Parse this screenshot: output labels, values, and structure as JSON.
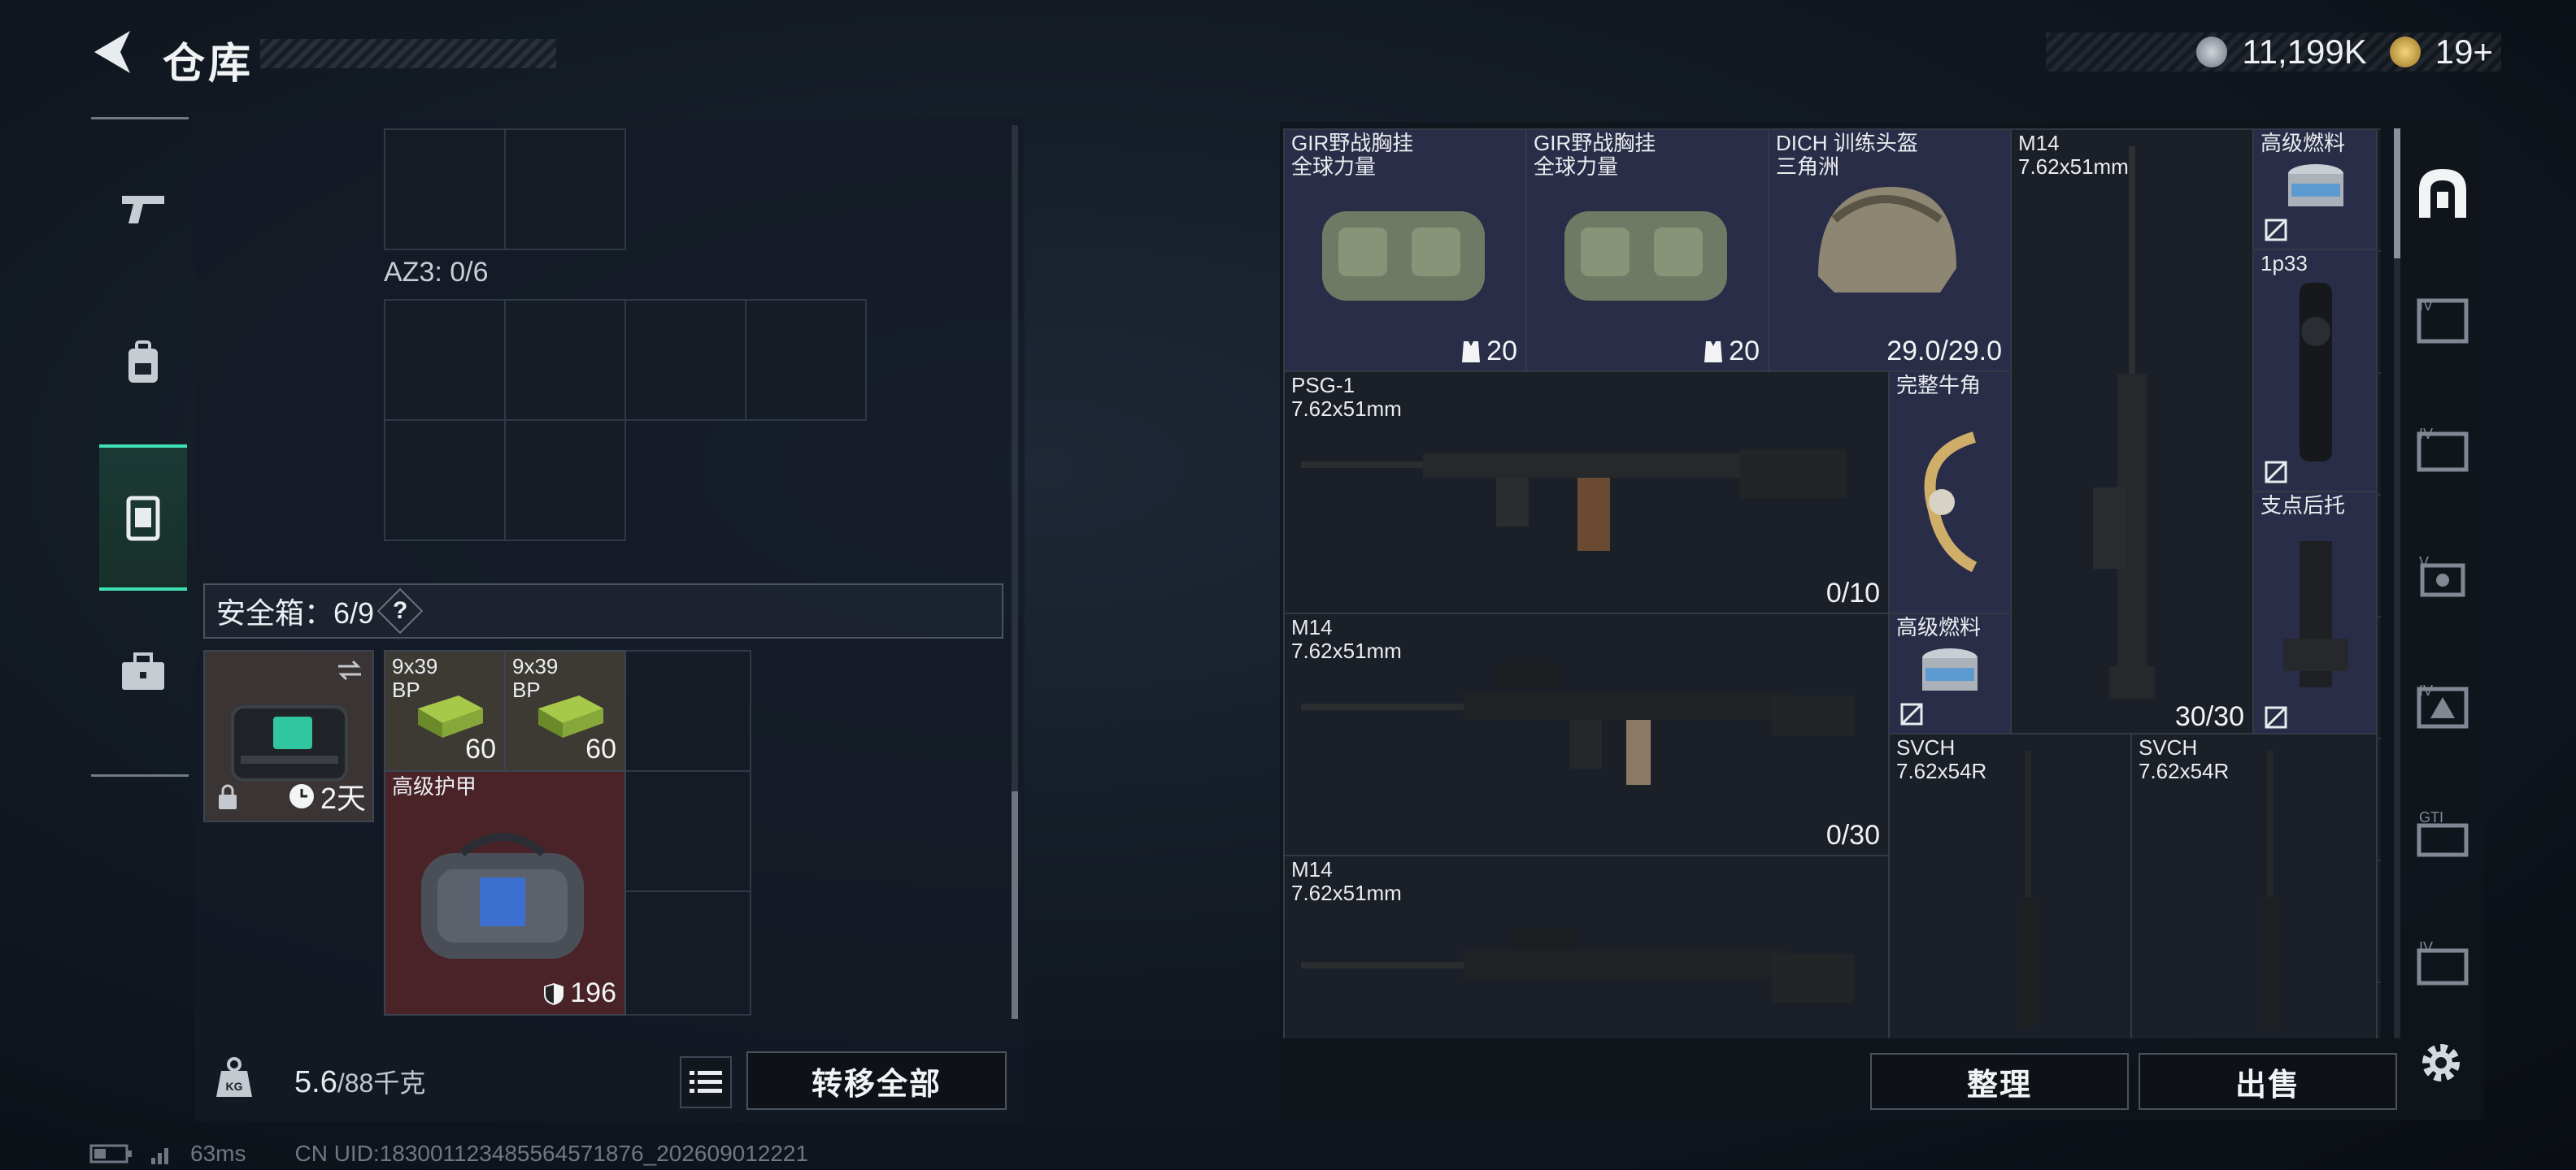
{
  "header": {
    "title": "仓库",
    "currency": [
      {
        "icon": "silver-coin-icon",
        "value": "11,199K"
      },
      {
        "icon": "gold-coin-icon",
        "value": "19+"
      }
    ]
  },
  "side_nav": [
    {
      "name": "weapon-tab",
      "icon": "pistol-icon"
    },
    {
      "name": "backpack-tab",
      "icon": "backpack-icon"
    },
    {
      "name": "chest-rig-tab",
      "icon": "vest-icon",
      "active": true
    },
    {
      "name": "safe-box-tab",
      "icon": "briefcase-icon"
    }
  ],
  "left": {
    "az3_label": "AZ3: 0/6",
    "safe_label": "安全箱：6/9",
    "help": "?",
    "safebox": {
      "duration": "2天"
    },
    "items": [
      {
        "name": "9x39\nBP",
        "count": "60"
      },
      {
        "name": "9x39\nBP",
        "count": "60"
      },
      {
        "name": "高级护甲",
        "count": "196"
      }
    ],
    "weight_value": "5.6",
    "weight_total": "/88千克",
    "transfer_all": "转移全部"
  },
  "right": {
    "items": [
      {
        "name": "GIR野战胸挂\n全球力量",
        "count": "20"
      },
      {
        "name": "GIR野战胸挂\n全球力量",
        "count": "20"
      },
      {
        "name": "DICH 训练头盔\n三角洲",
        "count": "29.0/29.0"
      },
      {
        "name": "M14\n7.62x51mm",
        "count": "30/30"
      },
      {
        "name": "高级燃料",
        "count": ""
      },
      {
        "name": "1p33",
        "count": ""
      },
      {
        "name": "PSG-1\n7.62x51mm",
        "count": "0/10"
      },
      {
        "name": "完整牛角",
        "count": ""
      },
      {
        "name": "支点后托",
        "count": ""
      },
      {
        "name": "M14\n7.62x51mm",
        "count": "0/30"
      },
      {
        "name": "高级燃料",
        "count": ""
      },
      {
        "name": "SVCH\n7.62x54R",
        "count": ""
      },
      {
        "name": "SVCH\n7.62x54R",
        "count": ""
      },
      {
        "name": "M14\n7.62x51mm",
        "count": ""
      }
    ],
    "sort_button": "整理",
    "sell_button": "出售"
  },
  "right_tabs": [
    "loot-box-icon",
    "armor-level-4-icon",
    "folder-level-4-icon",
    "vision-level-5-icon",
    "armor-level-4-alt-icon",
    "gti-icon",
    "level-4-crate-icon"
  ],
  "status": {
    "ping": "63ms",
    "uid": "CN UID:18300112348556457187­6_202609012221"
  },
  "colors": {
    "accent": "#3fe0b4",
    "item_purple": "#2a2d47",
    "item_red": "#4a2328"
  }
}
